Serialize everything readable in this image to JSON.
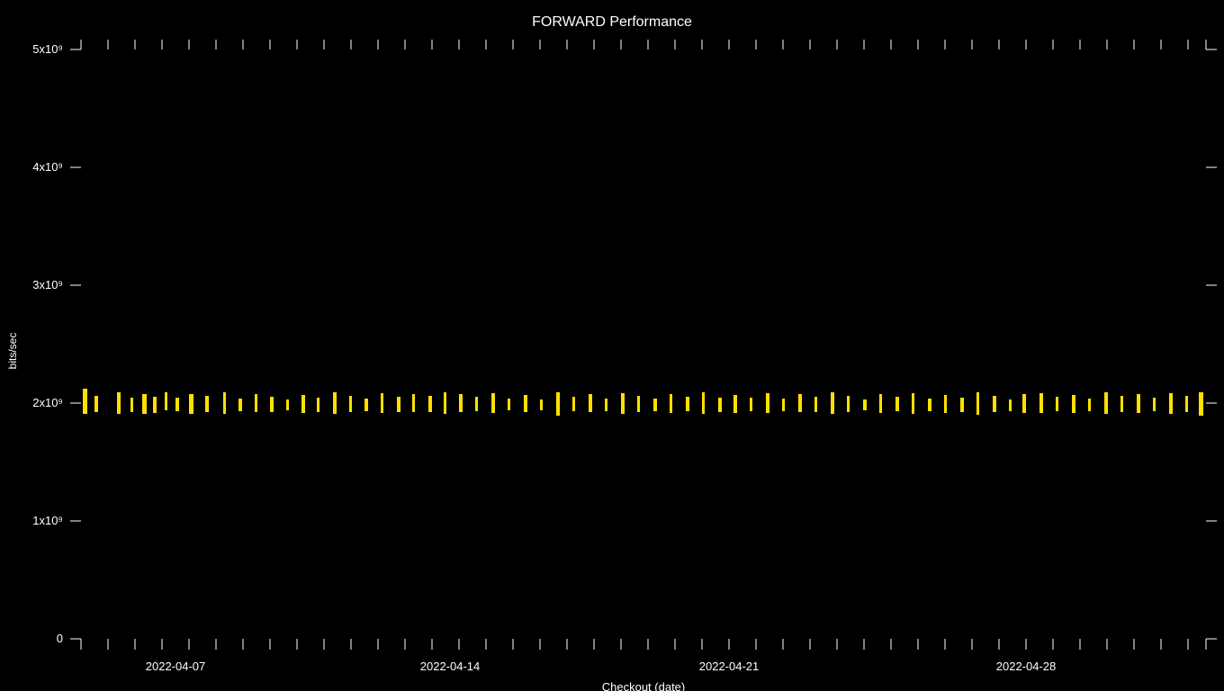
{
  "chart": {
    "title": "FORWARD Performance",
    "x_axis_label": "Checkout (date)",
    "y_axis_label": "bits/sec",
    "y_ticks": [
      {
        "label": "5x10⁹",
        "value": 5000000000
      },
      {
        "label": "4x10⁹",
        "value": 4000000000
      },
      {
        "label": "3x10⁹",
        "value": 3000000000
      },
      {
        "label": "2x10⁹",
        "value": 2000000000
      },
      {
        "label": "1x10⁹",
        "value": 1000000000
      },
      {
        "label": "0",
        "value": 0
      }
    ],
    "x_ticks": [
      {
        "label": "2022-04-07",
        "position": 0.15
      },
      {
        "label": "2022-04-14",
        "position": 0.38
      },
      {
        "label": "2022-04-21",
        "position": 0.61
      },
      {
        "label": "2022-04-28",
        "position": 0.84
      }
    ],
    "data_color": "#FFE000",
    "background": "#000000"
  }
}
